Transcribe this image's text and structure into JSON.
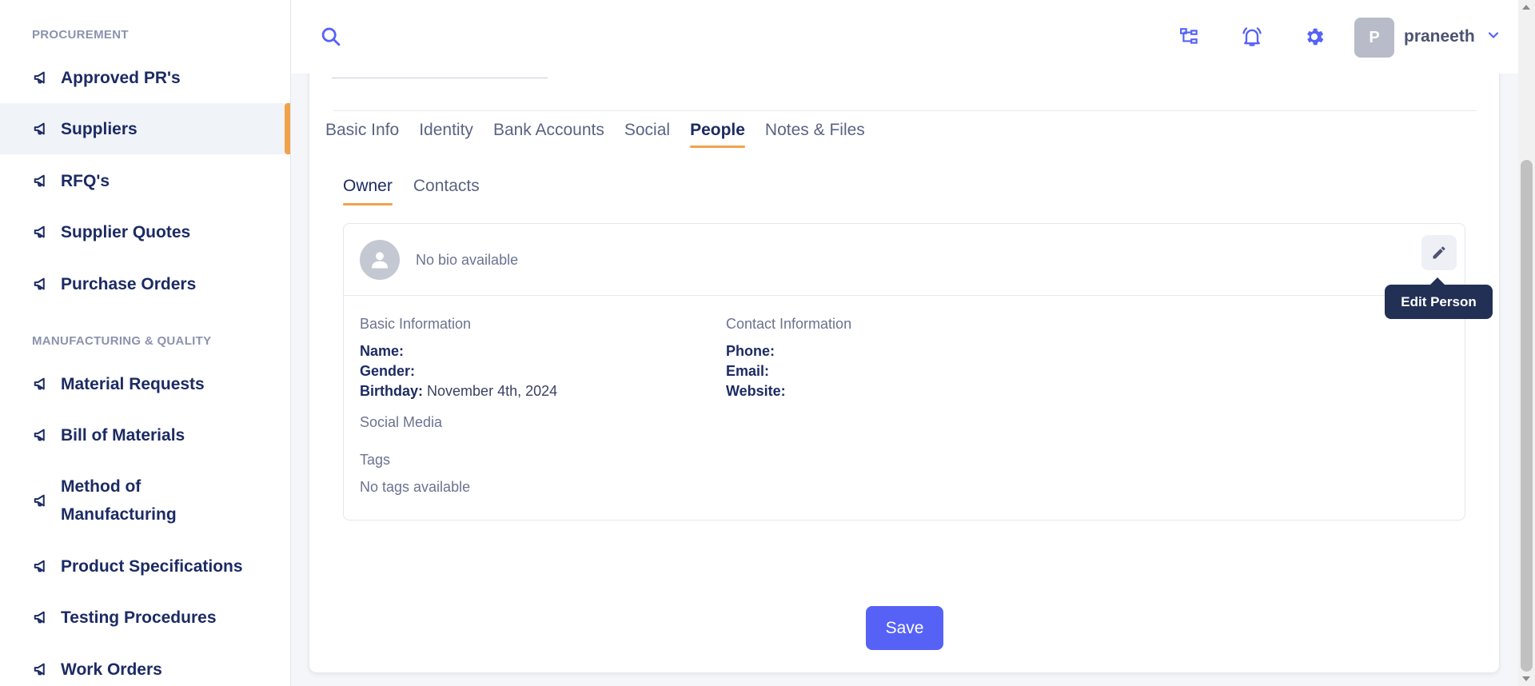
{
  "sidebar": {
    "sections": [
      {
        "title": "PROCUREMENT",
        "items": [
          {
            "label": "Approved PR's",
            "icon": "megaphone-icon"
          },
          {
            "label": "Suppliers",
            "icon": "megaphone-icon",
            "active": true
          },
          {
            "label": "RFQ's",
            "icon": "megaphone-icon"
          },
          {
            "label": "Supplier Quotes",
            "icon": "megaphone-icon"
          },
          {
            "label": "Purchase Orders",
            "icon": "megaphone-icon"
          }
        ]
      },
      {
        "title": "MANUFACTURING & QUALITY",
        "items": [
          {
            "label": "Material Requests",
            "icon": "megaphone-icon"
          },
          {
            "label": "Bill of Materials",
            "icon": "megaphone-icon"
          },
          {
            "label": "Method of Manufacturing",
            "icon": "megaphone-icon"
          },
          {
            "label": "Product Specifications",
            "icon": "megaphone-icon"
          },
          {
            "label": "Testing Procedures",
            "icon": "megaphone-icon"
          },
          {
            "label": "Work Orders",
            "icon": "megaphone-icon"
          }
        ]
      }
    ]
  },
  "topbar": {
    "user_initial": "P",
    "username": "praneeth",
    "icons": [
      "search-icon",
      "org-chart-icon",
      "bell-icon",
      "gear-icon",
      "chevron-down-icon"
    ]
  },
  "tabs": [
    "Basic Info",
    "Identity",
    "Bank Accounts",
    "Social",
    "People",
    "Notes & Files"
  ],
  "active_tab": "People",
  "subtabs": [
    "Owner",
    "Contacts"
  ],
  "active_subtab": "Owner",
  "person": {
    "bio": "No bio available",
    "edit_tooltip": "Edit Person",
    "basic_info_title": "Basic Information",
    "name_label": "Name:",
    "name_value": "",
    "gender_label": "Gender:",
    "gender_value": "",
    "birthday_label": "Birthday:",
    "birthday_value": "November 4th, 2024",
    "contact_info_title": "Contact Information",
    "phone_label": "Phone:",
    "phone_value": "",
    "email_label": "Email:",
    "email_value": "",
    "website_label": "Website:",
    "website_value": "",
    "social_media_title": "Social Media",
    "tags_title": "Tags",
    "tags_empty": "No tags available"
  },
  "save_label": "Save",
  "colors": {
    "accent": "#5662f6",
    "tab_underline": "#f0a24a",
    "nav_text": "#1c2b63",
    "tooltip_bg": "#223055"
  }
}
